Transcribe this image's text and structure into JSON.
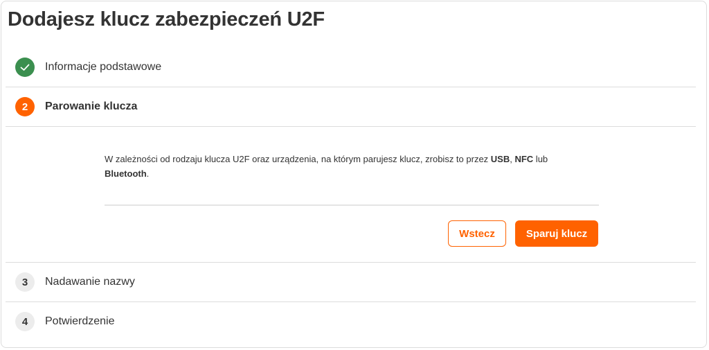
{
  "page": {
    "title": "Dodajesz klucz zabezpieczeń U2F"
  },
  "steps": [
    {
      "number": "✓",
      "label": "Informacje podstawowe",
      "status": "done",
      "icon": "check-icon"
    },
    {
      "number": "2",
      "label": "Parowanie klucza",
      "status": "active"
    },
    {
      "number": "3",
      "label": "Nadawanie nazwy",
      "status": "todo"
    },
    {
      "number": "4",
      "label": "Potwierdzenie",
      "status": "todo"
    }
  ],
  "pairing": {
    "desc_part1": "W zależności od rodzaju klucza U2F oraz urządzenia, na którym parujesz klucz, zrobisz to przez ",
    "usb": "USB",
    "sep": ", ",
    "nfc": "NFC",
    "lub": " lub",
    "bluetooth": "Bluetooth",
    "end": ".",
    "back_label": "Wstecz",
    "pair_label": "Sparuj klucz"
  },
  "colors": {
    "accent": "#ff6200",
    "done": "#3b8f4f",
    "todo_bg": "#ececec",
    "divider": "#dcdcdc"
  }
}
